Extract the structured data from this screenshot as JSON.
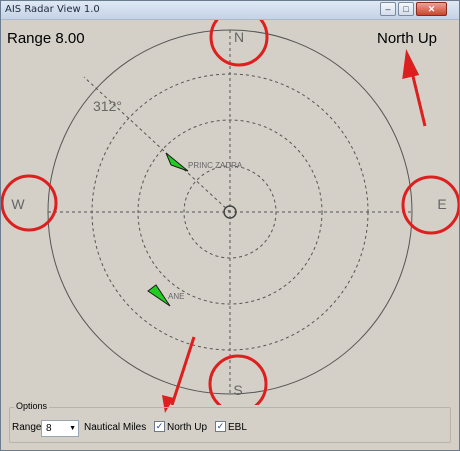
{
  "window": {
    "title": "AIS Radar View 1.0",
    "min_glyph": "–",
    "max_glyph": "□",
    "close_glyph": "✕"
  },
  "radar": {
    "range_text": "Range 8.00",
    "orientation_text": "North Up",
    "bearing_text": "312°",
    "ebl_bearing_deg": 312,
    "compass": {
      "north": "N",
      "south": "S",
      "east": "E",
      "west": "W"
    },
    "vessels": [
      {
        "name": "PRINC ZADRA",
        "color": "#22cc22"
      },
      {
        "name": "ANE",
        "color": "#22cc22"
      }
    ],
    "annotation_color": "#dd1f1f"
  },
  "options": {
    "legend": "Options",
    "range_label": "Range",
    "range_value": "8",
    "units_label": "Nautical Miles",
    "north_up_label": "North Up",
    "north_up_checked": true,
    "ebl_label": "EBL",
    "ebl_checked": true,
    "check_glyph": "✓"
  }
}
